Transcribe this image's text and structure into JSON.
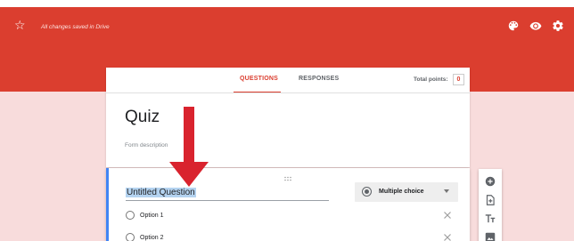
{
  "header": {
    "status": "All changes saved in Drive",
    "icons": [
      "star-icon",
      "palette-icon",
      "eye-icon",
      "gear-icon"
    ]
  },
  "form": {
    "tabs": [
      {
        "label": "QUESTIONS",
        "active": true
      },
      {
        "label": "RESPONSES",
        "active": false
      }
    ],
    "points_label": "Total points:",
    "points_value": "0",
    "title": "Quiz",
    "description_placeholder": "Form description"
  },
  "question": {
    "title": "Untitled Question",
    "type": "Multiple choice",
    "options": [
      {
        "label": "Option 1"
      },
      {
        "label": "Option 2"
      }
    ]
  },
  "side_toolbar": [
    "add-question-icon",
    "import-questions-icon",
    "add-title-icon",
    "add-image-icon"
  ],
  "colors": {
    "brand": "#db3e2f",
    "page_background": "#f8dcdc",
    "focus_accent": "#4285f4",
    "annotation_arrow": "#d9232e"
  }
}
